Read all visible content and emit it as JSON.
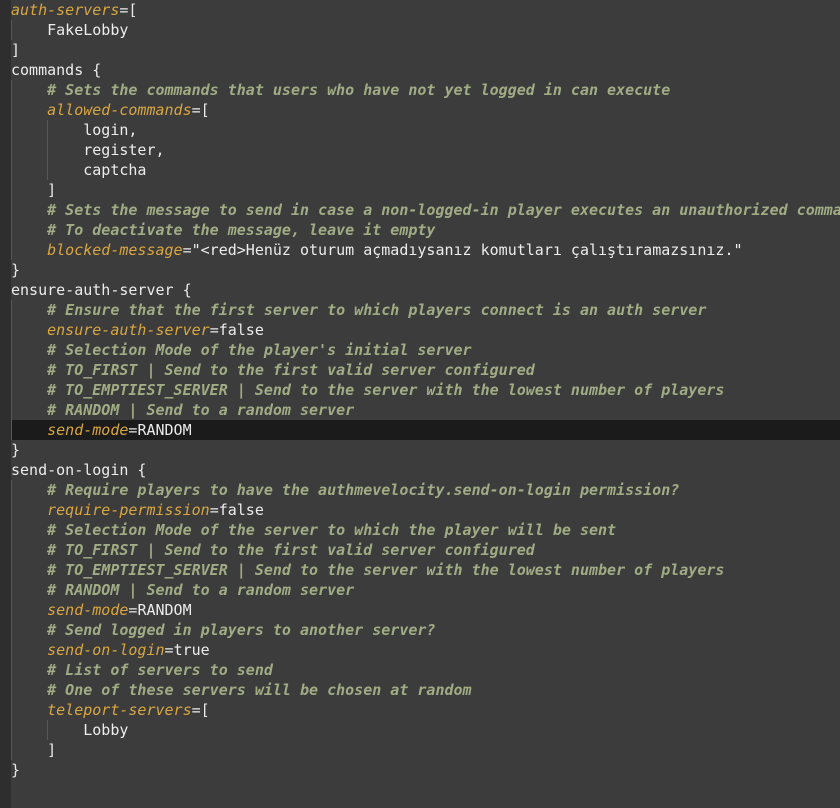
{
  "lines": [
    {
      "indent": 0,
      "parts": [
        {
          "c": "key",
          "t": "auth-servers"
        },
        {
          "c": "pun",
          "t": "=["
        }
      ]
    },
    {
      "indent": 1,
      "parts": [
        {
          "c": "val",
          "t": "FakeLobby"
        }
      ]
    },
    {
      "indent": 0,
      "parts": [
        {
          "c": "pun",
          "t": "]"
        }
      ]
    },
    {
      "indent": 0,
      "parts": [
        {
          "c": "val",
          "t": "commands {"
        }
      ]
    },
    {
      "indent": 1,
      "parts": [
        {
          "c": "cmt",
          "t": "# Sets the commands that users who have not yet logged in can execute"
        }
      ]
    },
    {
      "indent": 1,
      "parts": [
        {
          "c": "key",
          "t": "allowed-commands"
        },
        {
          "c": "pun",
          "t": "=["
        }
      ]
    },
    {
      "indent": 2,
      "parts": [
        {
          "c": "val",
          "t": "login,"
        }
      ]
    },
    {
      "indent": 2,
      "parts": [
        {
          "c": "val",
          "t": "register,"
        }
      ]
    },
    {
      "indent": 2,
      "parts": [
        {
          "c": "val",
          "t": "captcha"
        }
      ]
    },
    {
      "indent": 1,
      "parts": [
        {
          "c": "pun",
          "t": "]"
        }
      ]
    },
    {
      "indent": 1,
      "parts": [
        {
          "c": "cmt",
          "t": "# Sets the message to send in case a non-logged-in player executes an unauthorized command"
        }
      ]
    },
    {
      "indent": 1,
      "parts": [
        {
          "c": "cmt",
          "t": "# To deactivate the message, leave it empty"
        }
      ]
    },
    {
      "indent": 1,
      "parts": [
        {
          "c": "key",
          "t": "blocked-message"
        },
        {
          "c": "pun",
          "t": "="
        },
        {
          "c": "str",
          "t": "\"<red>Henüz oturum açmadıysanız komutları çalıştıramazsınız.\""
        }
      ]
    },
    {
      "indent": 0,
      "parts": [
        {
          "c": "pun",
          "t": "}"
        }
      ]
    },
    {
      "indent": 0,
      "parts": [
        {
          "c": "val",
          "t": "ensure-auth-server {"
        }
      ]
    },
    {
      "indent": 1,
      "parts": [
        {
          "c": "cmt",
          "t": "# Ensure that the first server to which players connect is an auth server"
        }
      ]
    },
    {
      "indent": 1,
      "parts": [
        {
          "c": "key",
          "t": "ensure-auth-server"
        },
        {
          "c": "pun",
          "t": "="
        },
        {
          "c": "val",
          "t": "false"
        }
      ]
    },
    {
      "indent": 1,
      "parts": [
        {
          "c": "cmt",
          "t": "# Selection Mode of the player's initial server"
        }
      ]
    },
    {
      "indent": 1,
      "parts": [
        {
          "c": "cmt",
          "t": "# TO_FIRST | Send to the first valid server configured"
        }
      ]
    },
    {
      "indent": 1,
      "parts": [
        {
          "c": "cmt",
          "t": "# TO_EMPTIEST_SERVER | Send to the server with the lowest number of players"
        }
      ]
    },
    {
      "indent": 1,
      "parts": [
        {
          "c": "cmt",
          "t": "# RANDOM | Send to a random server"
        }
      ]
    },
    {
      "indent": 1,
      "current": true,
      "parts": [
        {
          "c": "key",
          "t": "send-mode"
        },
        {
          "c": "pun",
          "t": "="
        },
        {
          "c": "val",
          "t": "RANDOM"
        }
      ]
    },
    {
      "indent": 0,
      "parts": [
        {
          "c": "pun",
          "t": "}"
        }
      ]
    },
    {
      "indent": 0,
      "parts": [
        {
          "c": "val",
          "t": "send-on-login {"
        }
      ]
    },
    {
      "indent": 1,
      "parts": [
        {
          "c": "cmt",
          "t": "# Require players to have the authmevelocity.send-on-login permission?"
        }
      ]
    },
    {
      "indent": 1,
      "parts": [
        {
          "c": "key",
          "t": "require-permission"
        },
        {
          "c": "pun",
          "t": "="
        },
        {
          "c": "val",
          "t": "false"
        }
      ]
    },
    {
      "indent": 1,
      "parts": [
        {
          "c": "cmt",
          "t": "# Selection Mode of the server to which the player will be sent"
        }
      ]
    },
    {
      "indent": 1,
      "parts": [
        {
          "c": "cmt",
          "t": "# TO_FIRST | Send to the first valid server configured"
        }
      ]
    },
    {
      "indent": 1,
      "parts": [
        {
          "c": "cmt",
          "t": "# TO_EMPTIEST_SERVER | Send to the server with the lowest number of players"
        }
      ]
    },
    {
      "indent": 1,
      "parts": [
        {
          "c": "cmt",
          "t": "# RANDOM | Send to a random server"
        }
      ]
    },
    {
      "indent": 1,
      "parts": [
        {
          "c": "key",
          "t": "send-mode"
        },
        {
          "c": "pun",
          "t": "="
        },
        {
          "c": "val",
          "t": "RANDOM"
        }
      ]
    },
    {
      "indent": 1,
      "parts": [
        {
          "c": "cmt",
          "t": "# Send logged in players to another server?"
        }
      ]
    },
    {
      "indent": 1,
      "parts": [
        {
          "c": "key",
          "t": "send-on-login"
        },
        {
          "c": "pun",
          "t": "="
        },
        {
          "c": "val",
          "t": "true"
        }
      ]
    },
    {
      "indent": 1,
      "parts": [
        {
          "c": "cmt",
          "t": "# List of servers to send"
        }
      ]
    },
    {
      "indent": 1,
      "parts": [
        {
          "c": "cmt",
          "t": "# One of these servers will be chosen at random"
        }
      ]
    },
    {
      "indent": 1,
      "parts": [
        {
          "c": "key",
          "t": "teleport-servers"
        },
        {
          "c": "pun",
          "t": "=["
        }
      ]
    },
    {
      "indent": 2,
      "parts": [
        {
          "c": "val",
          "t": "Lobby"
        }
      ]
    },
    {
      "indent": 1,
      "parts": [
        {
          "c": "pun",
          "t": "]"
        }
      ]
    },
    {
      "indent": 0,
      "parts": [
        {
          "c": "pun",
          "t": "}"
        }
      ]
    }
  ]
}
